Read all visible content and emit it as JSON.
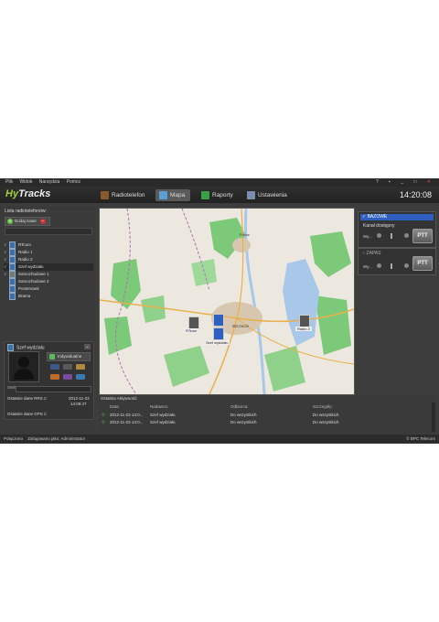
{
  "menu": [
    "Plik",
    "Widok",
    "Narzędzia",
    "Pomoc"
  ],
  "window_controls": [
    "?",
    "▪",
    "_",
    "□",
    "✕"
  ],
  "logo": {
    "prefix": "Hy",
    "suffix": "Tracks"
  },
  "tabs": [
    {
      "label": "Radiotelefon"
    },
    {
      "label": "Mapa"
    },
    {
      "label": "Raporty"
    },
    {
      "label": "Ustawienia"
    }
  ],
  "clock": "14:20:08",
  "left": {
    "title": "Lista radiotelefonów:",
    "add_label": "Dodaj nowe",
    "radios": [
      {
        "name": "RTcom",
        "checked": true
      },
      {
        "name": "Radio 1",
        "checked": true
      },
      {
        "name": "Radio 2",
        "checked": true
      },
      {
        "name": "Szef wydziału",
        "checked": true
      },
      {
        "name": "Samochodowe 1",
        "checked": true
      },
      {
        "name": "Samochodowe 2",
        "checked": false
      },
      {
        "name": "Posterunek",
        "checked": false
      },
      {
        "name": "Brama",
        "checked": false
      }
    ],
    "selected": {
      "name": "Szef wydziału",
      "mode": "Indywidualne",
      "sms_label": "SMS",
      "last_rrs_label": "Ostatnie dane RRS z:",
      "last_rrs_date": "2012-11-23",
      "last_rrs_time": "14:09:47",
      "last_gps_label": "Ostatnie dane GPS z:"
    }
  },
  "map_labels": {
    "city": "Szczecin",
    "marker1": "RTcom",
    "marker2": "Szef wydziału",
    "marker3": "Radio 2",
    "police": "Police"
  },
  "right": {
    "group1": {
      "name": "BAZOWE",
      "channel": "Kanał dostępny",
      "wy": "Wy...",
      "ptt": "PTT"
    },
    "group2": {
      "name": "ZAPAS",
      "wy": "Wy...",
      "ptt": "PTT"
    }
  },
  "activity": {
    "title": "Ostatnia Aktywność:",
    "columns": [
      "Data:",
      "Nadawca:",
      "Odbiorca:",
      "Szczegóły:"
    ],
    "rows": [
      [
        "2012-11-23 14:0...",
        "Szef wydziału",
        "Do wszystkich",
        "Do wszystkich"
      ],
      [
        "2012-11-23 14:0...",
        "Szef wydziału",
        "Do wszystkich",
        "Do wszystkich"
      ]
    ]
  },
  "status": {
    "connection": "Połączono",
    "user": "Zalogowano jako: Administrator",
    "copyright": "© BPC Telecom"
  },
  "colors": {
    "accent": "#9fd23a",
    "panel": "#3c3c3c",
    "selection": "#2f5fbf",
    "map_green": "#7cc97a",
    "water": "#a9c7e8"
  }
}
